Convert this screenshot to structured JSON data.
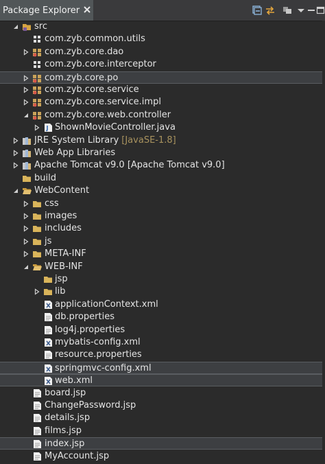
{
  "view": {
    "tab_title": "Package Explorer",
    "toolbar": [
      "collapse-all-icon",
      "link-with-editor-icon",
      "focus-on-active-task-icon",
      "view-menu-icon",
      "minimize-icon",
      "maximize-icon"
    ]
  },
  "tree": [
    {
      "label": "src",
      "depth": 1,
      "arrow": "expanded",
      "icon": "source-folder"
    },
    {
      "label": "com.zyb.common.utils",
      "depth": 2,
      "arrow": "none",
      "icon": "package-empty"
    },
    {
      "label": "com.zyb.core.dao",
      "depth": 2,
      "arrow": "collapsed",
      "icon": "package"
    },
    {
      "label": "com.zyb.core.interceptor",
      "depth": 2,
      "arrow": "none",
      "icon": "package-empty"
    },
    {
      "label": "com.zyb.core.po",
      "depth": 2,
      "arrow": "collapsed",
      "icon": "package",
      "selected": true
    },
    {
      "label": "com.zyb.core.service",
      "depth": 2,
      "arrow": "collapsed",
      "icon": "package"
    },
    {
      "label": "com.zyb.core.service.impl",
      "depth": 2,
      "arrow": "collapsed",
      "icon": "package"
    },
    {
      "label": "com.zyb.core.web.controller",
      "depth": 2,
      "arrow": "expanded",
      "icon": "package"
    },
    {
      "label": "ShownMovieController.java",
      "depth": 3,
      "arrow": "collapsed",
      "icon": "java-file"
    },
    {
      "label": "JRE System Library",
      "decoration": "[JavaSE-1.8]",
      "depth": 1,
      "arrow": "collapsed",
      "icon": "library"
    },
    {
      "label": "Web App Libraries",
      "depth": 1,
      "arrow": "collapsed",
      "icon": "library"
    },
    {
      "label": "Apache Tomcat v9.0 [Apache Tomcat v9.0]",
      "depth": 1,
      "arrow": "collapsed",
      "icon": "library"
    },
    {
      "label": "build",
      "depth": 1,
      "arrow": "none",
      "icon": "folder"
    },
    {
      "label": "WebContent",
      "depth": 1,
      "arrow": "expanded",
      "icon": "folder-open"
    },
    {
      "label": "css",
      "depth": 2,
      "arrow": "collapsed",
      "icon": "folder"
    },
    {
      "label": "images",
      "depth": 2,
      "arrow": "collapsed",
      "icon": "folder"
    },
    {
      "label": "includes",
      "depth": 2,
      "arrow": "collapsed",
      "icon": "folder"
    },
    {
      "label": "js",
      "depth": 2,
      "arrow": "collapsed",
      "icon": "folder"
    },
    {
      "label": "META-INF",
      "depth": 2,
      "arrow": "collapsed",
      "icon": "folder"
    },
    {
      "label": "WEB-INF",
      "depth": 2,
      "arrow": "expanded",
      "icon": "folder-open"
    },
    {
      "label": "jsp",
      "depth": 3,
      "arrow": "none",
      "icon": "folder"
    },
    {
      "label": "lib",
      "depth": 3,
      "arrow": "collapsed",
      "icon": "folder"
    },
    {
      "label": "applicationContext.xml",
      "depth": 3,
      "arrow": "none",
      "icon": "xml-file"
    },
    {
      "label": "db.properties",
      "depth": 3,
      "arrow": "none",
      "icon": "text-file"
    },
    {
      "label": "log4j.properties",
      "depth": 3,
      "arrow": "none",
      "icon": "text-file"
    },
    {
      "label": "mybatis-config.xml",
      "depth": 3,
      "arrow": "none",
      "icon": "xml-file"
    },
    {
      "label": "resource.properties",
      "depth": 3,
      "arrow": "none",
      "icon": "text-file"
    },
    {
      "label": "springmvc-config.xml",
      "depth": 3,
      "arrow": "none",
      "icon": "xml-file",
      "selected": true
    },
    {
      "label": "web.xml",
      "depth": 3,
      "arrow": "none",
      "icon": "xml-file",
      "selected": true
    },
    {
      "label": "board.jsp",
      "depth": 2,
      "arrow": "none",
      "icon": "text-file"
    },
    {
      "label": "ChangePassword.jsp",
      "depth": 2,
      "arrow": "none",
      "icon": "text-file"
    },
    {
      "label": "details.jsp",
      "depth": 2,
      "arrow": "none",
      "icon": "text-file"
    },
    {
      "label": "films.jsp",
      "depth": 2,
      "arrow": "none",
      "icon": "text-file"
    },
    {
      "label": "index.jsp",
      "depth": 2,
      "arrow": "none",
      "icon": "text-file",
      "selected": true
    },
    {
      "label": "MyAccount.jsp",
      "depth": 2,
      "arrow": "none",
      "icon": "text-file"
    }
  ]
}
